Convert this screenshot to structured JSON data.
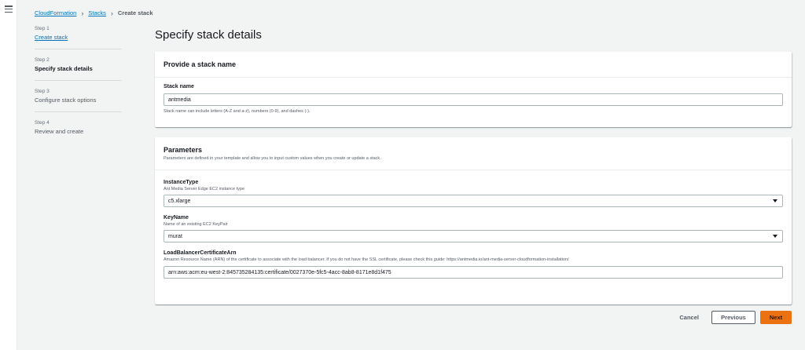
{
  "breadcrumb": {
    "items": [
      "CloudFormation",
      "Stacks"
    ],
    "current": "Create stack"
  },
  "steps": [
    {
      "num": "Step 1",
      "label": "Create stack"
    },
    {
      "num": "Step 2",
      "label": "Specify stack details"
    },
    {
      "num": "Step 3",
      "label": "Configure stack options"
    },
    {
      "num": "Step 4",
      "label": "Review and create"
    }
  ],
  "page": {
    "title": "Specify stack details"
  },
  "stack_name_panel": {
    "title": "Provide a stack name",
    "field_label": "Stack name",
    "value": "antmedia",
    "hint": "Stack name can include letters (A-Z and a-z), numbers (0-9), and dashes (-)."
  },
  "parameters_panel": {
    "title": "Parameters",
    "description": "Parameters are defined in your template and allow you to input custom values when you create or update a stack.",
    "instance_type": {
      "label": "InstanceType",
      "description": "Ant Media Server Edge EC2 instance type",
      "value": "c5.xlarge"
    },
    "key_name": {
      "label": "KeyName",
      "description": "Name of an existing EC2 KeyPair",
      "value": "murat"
    },
    "cert_arn": {
      "label": "LoadBalancerCertificateArn",
      "description": "Amazon Resource Name (ARN) of the certificate to associate with the load balancer. If you do not have the SSL certificate, please check this guide: https://antmedia.io/ant-media-server-cloudformation-installation/",
      "value": "arn:aws:acm:eu-west-2:845735284135:certificate/0027370e-5fc5-4acc-8ab8-8171e8d1f475"
    }
  },
  "actions": {
    "cancel": "Cancel",
    "previous": "Previous",
    "next": "Next"
  },
  "icons": {
    "menu": "hamburger-icon",
    "breadcrumb_separator": "chevron-right-icon",
    "select_caret": "caret-down-icon"
  },
  "colors": {
    "link": "#0073bb",
    "primary_button": "#ec7211",
    "background": "#f2f3f3"
  }
}
